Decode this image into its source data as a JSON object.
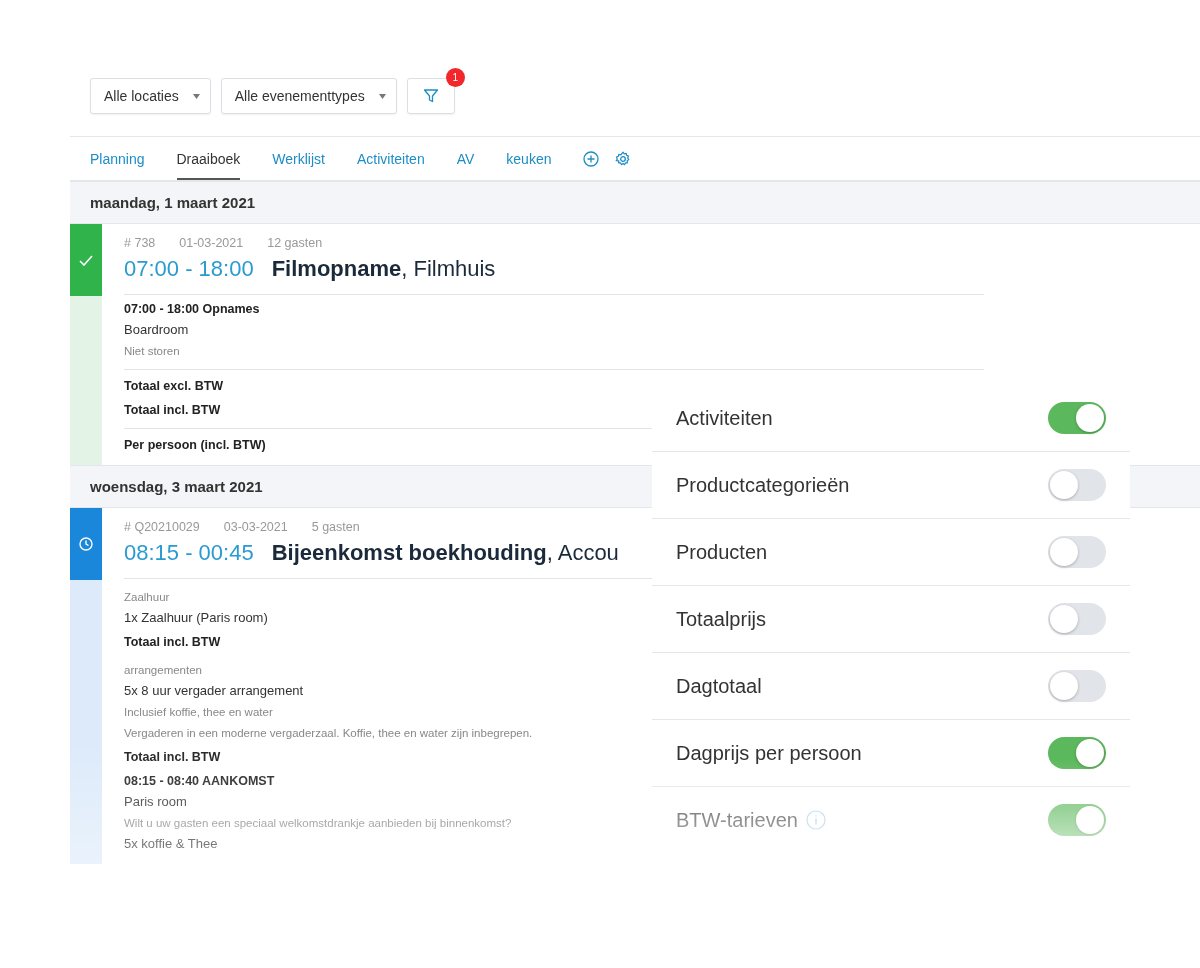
{
  "filters": [
    {
      "label": "Alle locaties"
    },
    {
      "label": "Alle evenementtypes"
    }
  ],
  "filter_button": {
    "badge": "1"
  },
  "tabs": [
    {
      "label": "Planning",
      "selected": false
    },
    {
      "label": "Draaiboek",
      "selected": true
    },
    {
      "label": "Werklijst",
      "selected": false
    },
    {
      "label": "Activiteiten",
      "selected": false
    },
    {
      "label": "AV",
      "selected": false
    },
    {
      "label": "keuken",
      "selected": false
    }
  ],
  "days": [
    {
      "date": "maandag, 1 maart 2021",
      "events": [
        {
          "kind": "confirmed",
          "number": "# 738",
          "date": "01-03-2021",
          "guests": "12 gasten",
          "time": "07:00 - 18:00",
          "title": "Filmopname",
          "location": ", Filmhuis",
          "lines": [
            {
              "kind": "heading",
              "text": "07:00 - 18:00  Opnames"
            },
            {
              "kind": "text",
              "text": "Boardroom"
            },
            {
              "kind": "note",
              "text": "Niet storen"
            },
            {
              "kind": "divider"
            },
            {
              "kind": "heading",
              "text": "Totaal excl. BTW"
            },
            {
              "kind": "heading",
              "text": "Totaal incl. BTW"
            },
            {
              "kind": "divider"
            },
            {
              "kind": "heading",
              "text": "Per persoon (incl. BTW)"
            }
          ]
        }
      ]
    },
    {
      "date": "woensdag, 3 maart 2021",
      "events": [
        {
          "kind": "pending",
          "number": "# Q20210029",
          "date": "03-03-2021",
          "guests": "5 gasten",
          "time": "08:15 - 00:45",
          "title": "Bijeenkomst boekhouding",
          "location": ", Accou",
          "lines": [
            {
              "kind": "caption",
              "text": "Zaalhuur"
            },
            {
              "kind": "text",
              "text": "1x Zaalhuur (Paris room)"
            },
            {
              "kind": "heading",
              "text": "Totaal incl. BTW"
            },
            {
              "kind": "caption",
              "text": "arrangementen"
            },
            {
              "kind": "text",
              "text": "5x 8 uur vergader arrangement"
            },
            {
              "kind": "note",
              "text": "Inclusief koffie, thee en water"
            },
            {
              "kind": "note",
              "text": "Vergaderen in een moderne vergaderzaal. Koffie, thee en water zijn inbegrepen."
            },
            {
              "kind": "heading",
              "text": "Totaal incl. BTW"
            },
            {
              "kind": "heading",
              "text": "08:15 - 08:40  AANKOMST"
            },
            {
              "kind": "text",
              "text": "Paris room"
            },
            {
              "kind": "note",
              "text": "Wilt u uw gasten een speciaal welkomstdrankje aanbieden bij binnenkomst?"
            },
            {
              "kind": "text",
              "text": "5x koffie & Thee"
            }
          ]
        }
      ]
    }
  ],
  "settings": [
    {
      "label": "Activiteiten",
      "on": true
    },
    {
      "label": "Productcategorieën",
      "on": false
    },
    {
      "label": "Producten",
      "on": false
    },
    {
      "label": "Totaalprijs",
      "on": false
    },
    {
      "label": "Dagtotaal",
      "on": false
    },
    {
      "label": "Dagprijs per persoon",
      "on": true
    },
    {
      "label": "BTW-tarieven",
      "on": true,
      "info": true
    }
  ]
}
